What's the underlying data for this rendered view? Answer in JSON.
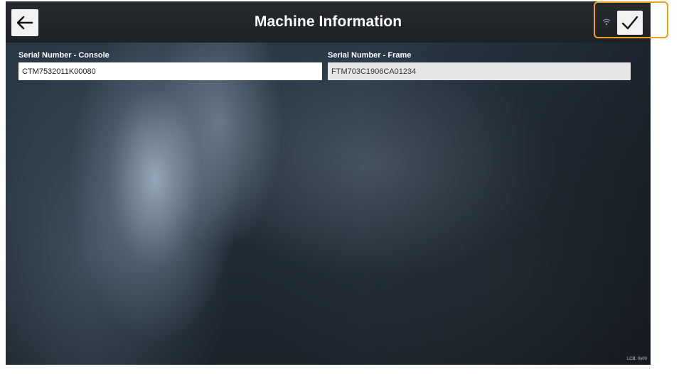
{
  "header": {
    "title": "Machine Information",
    "back_icon": "arrow-left-icon",
    "wifi_icon": "wifi-icon",
    "confirm_icon": "checkmark-icon"
  },
  "fields": {
    "console": {
      "label": "Serial Number - Console",
      "value": "CTM7532011K00080"
    },
    "frame": {
      "label": "Serial Number - Frame",
      "value": "FTM703C1906CA01234"
    }
  },
  "footer": {
    "lcb": "LCB: 0x00"
  },
  "colors": {
    "highlight": "#f0a020",
    "header_bg": "#22272b",
    "frame_field_bg": "#e7e7e7"
  }
}
